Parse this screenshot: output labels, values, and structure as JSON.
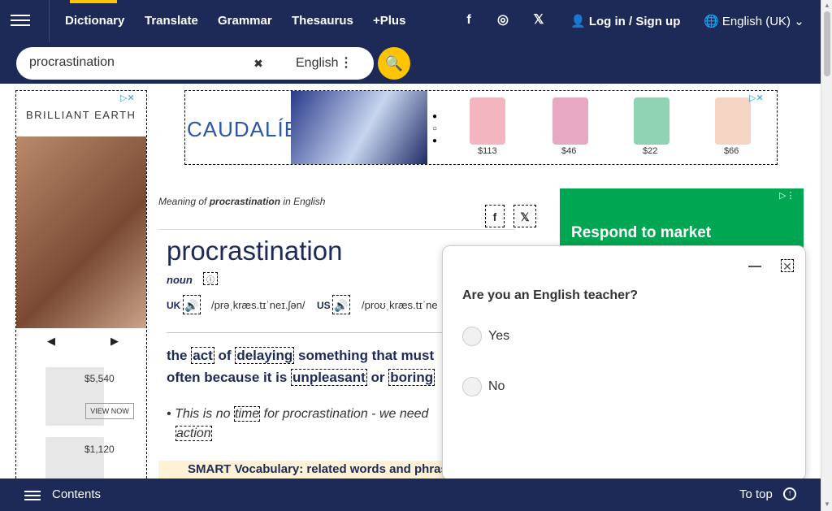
{
  "header": {
    "nav": [
      "Dictionary",
      "Translate",
      "Grammar",
      "Thesaurus",
      "+Plus"
    ],
    "login": "Log in",
    "slash": "/",
    "signup": "Sign up",
    "language": "English (UK)",
    "social": {
      "facebook": "f",
      "instagram": "◎",
      "x": "𝕏"
    }
  },
  "search": {
    "value": "procrastination",
    "dictionary": "English",
    "clear_glyph": "✖",
    "dots_glyph": "⋮",
    "go_glyph": "🔍"
  },
  "ad_left": {
    "brand": "BRILLIANT EARTH",
    "prev": "◀",
    "next": "▶",
    "items": [
      {
        "price": "$5,540",
        "cta": "VIEW NOW"
      },
      {
        "price": "$1,120"
      }
    ]
  },
  "ad_top": {
    "brand": "CAUDALÍE",
    "prices": [
      "$113",
      "$46",
      "$22",
      "$66"
    ],
    "colors": [
      "#f3b6c0",
      "#e7a8c1",
      "#8fd3b4",
      "#f4d4c3"
    ]
  },
  "ad_right": {
    "text": "Respond to market",
    "color": "#00a651"
  },
  "entry": {
    "meaning_prefix": "Meaning of",
    "meaning_word": "procrastination",
    "meaning_suffix": "in English",
    "headword": "procrastination",
    "pos": "noun",
    "uk_label": "UK",
    "uk_ipa": "/prəˌkræs.tɪˈneɪ.ʃən/",
    "us_label": "US",
    "us_ipa": "/proʊˌkræs.tɪˈne"
  },
  "definition": {
    "line1": [
      "the ",
      "act",
      " of ",
      "delaying",
      " something that must"
    ],
    "line2": [
      "often because it is ",
      "unpleasant",
      " or ",
      "boring"
    ]
  },
  "example": {
    "bullet": "•",
    "line1": [
      "This is no ",
      "time",
      " for procrastination - we need"
    ],
    "line2": "action"
  },
  "smart_vocab": "SMART Vocabulary: related words and phrases",
  "popup": {
    "question": "Are you an English teacher?",
    "yes": "Yes",
    "no": "No",
    "close": "✕"
  },
  "footer": {
    "contents": "Contents",
    "to_top": "To top"
  },
  "colors": {
    "navy": "#1d2a57",
    "accent": "#fec400"
  }
}
